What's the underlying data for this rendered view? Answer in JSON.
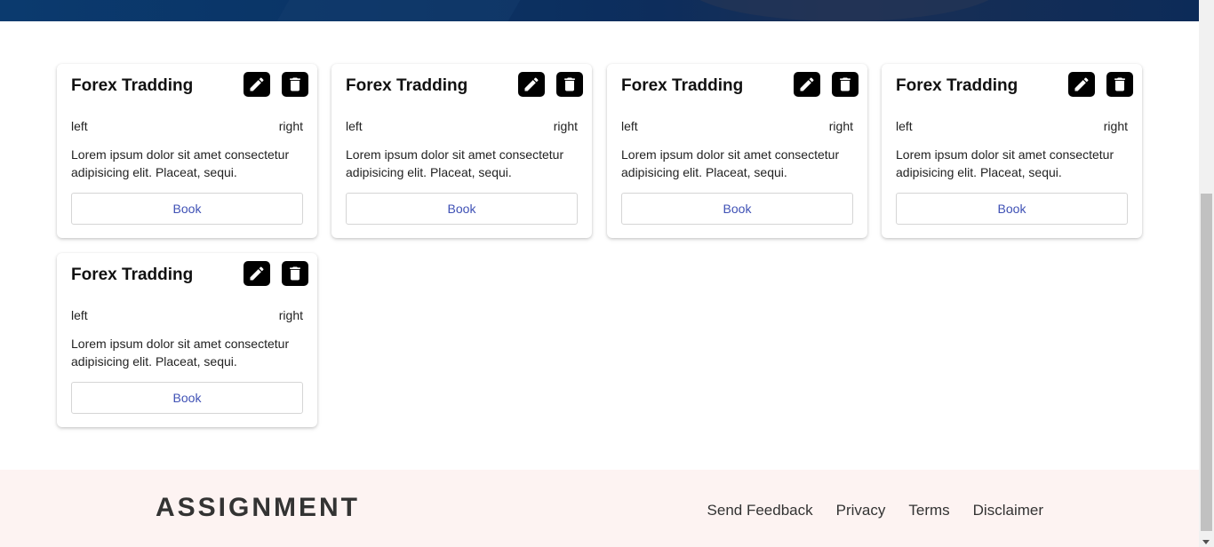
{
  "cards": [
    {
      "title": "Forex Tradding",
      "left": "left",
      "right": "right",
      "description": "Lorem ipsum dolor sit amet consectetur adipisicing elit. Placeat, sequi.",
      "button": "Book"
    },
    {
      "title": "Forex Tradding",
      "left": "left",
      "right": "right",
      "description": "Lorem ipsum dolor sit amet consectetur adipisicing elit. Placeat, sequi.",
      "button": "Book"
    },
    {
      "title": "Forex Tradding",
      "left": "left",
      "right": "right",
      "description": "Lorem ipsum dolor sit amet consectetur adipisicing elit. Placeat, sequi.",
      "button": "Book"
    },
    {
      "title": "Forex Tradding",
      "left": "left",
      "right": "right",
      "description": "Lorem ipsum dolor sit amet consectetur adipisicing elit. Placeat, sequi.",
      "button": "Book"
    },
    {
      "title": "Forex Tradding",
      "left": "left",
      "right": "right",
      "description": "Lorem ipsum dolor sit amet consectetur adipisicing elit. Placeat, sequi.",
      "button": "Book"
    }
  ],
  "icons": {
    "edit": "pencil-icon",
    "delete": "trash-icon"
  },
  "footer": {
    "brand": "ASSIGNMENT",
    "links": [
      "Send Feedback",
      "Privacy",
      "Terms",
      "Disclaimer"
    ]
  },
  "colors": {
    "hero": "#0b3a6e",
    "button_text": "#3f51b5",
    "footer_bg": "#fdf3f2"
  }
}
